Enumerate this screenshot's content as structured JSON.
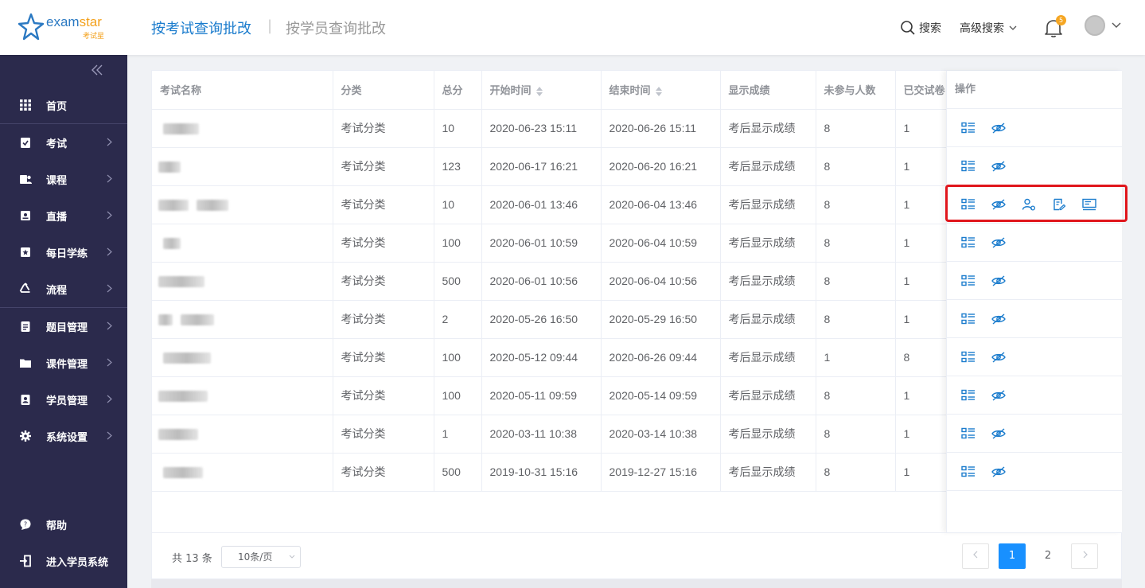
{
  "header": {
    "logo_text": "examstar",
    "logo_cn": "考试星",
    "tab_active": "按考试查询批改",
    "separator": "|",
    "tab_other": "按学员查询批改",
    "search_label": "搜索",
    "advanced_search_label": "高级搜索",
    "notification_count": "5"
  },
  "sidebar": {
    "items": [
      {
        "label": "首页",
        "icon": "grid-icon"
      },
      {
        "label": "考试",
        "icon": "clipboard-check-icon"
      },
      {
        "label": "课程",
        "icon": "course-icon"
      },
      {
        "label": "直播",
        "icon": "live-icon"
      },
      {
        "label": "每日学练",
        "icon": "star-calendar-icon"
      },
      {
        "label": "流程",
        "icon": "recycle-icon"
      },
      {
        "label": "题目管理",
        "icon": "clipboard-list-icon"
      },
      {
        "label": "课件管理",
        "icon": "folder-icon"
      },
      {
        "label": "学员管理",
        "icon": "user-badge-icon"
      },
      {
        "label": "系统设置",
        "icon": "gear-icon"
      },
      {
        "label": "帮助",
        "icon": "help-icon"
      },
      {
        "label": "进入学员系统",
        "icon": "enter-icon"
      }
    ]
  },
  "table": {
    "columns": [
      "考试名称",
      "分类",
      "总分",
      "开始时间",
      "结束时间",
      "显示成绩",
      "未参与人数",
      "已交试卷",
      "操作"
    ],
    "rows": [
      {
        "category": "考试分类",
        "score": "10",
        "start": "2020-06-23 15:11",
        "end": "2020-06-26 15:11",
        "display": "考后显示成绩",
        "absent": "8",
        "submitted": "1"
      },
      {
        "category": "考试分类",
        "score": "123",
        "start": "2020-06-17 16:21",
        "end": "2020-06-20 16:21",
        "display": "考后显示成绩",
        "absent": "8",
        "submitted": "1"
      },
      {
        "category": "考试分类",
        "score": "10",
        "start": "2020-06-01 13:46",
        "end": "2020-06-04 13:46",
        "display": "考后显示成绩",
        "absent": "8",
        "submitted": "1"
      },
      {
        "category": "考试分类",
        "score": "100",
        "start": "2020-06-01 10:59",
        "end": "2020-06-04 10:59",
        "display": "考后显示成绩",
        "absent": "8",
        "submitted": "1"
      },
      {
        "category": "考试分类",
        "score": "500",
        "start": "2020-06-01 10:56",
        "end": "2020-06-04 10:56",
        "display": "考后显示成绩",
        "absent": "8",
        "submitted": "1"
      },
      {
        "category": "考试分类",
        "score": "2",
        "start": "2020-05-26 16:50",
        "end": "2020-05-29 16:50",
        "display": "考后显示成绩",
        "absent": "8",
        "submitted": "1"
      },
      {
        "category": "考试分类",
        "score": "100",
        "start": "2020-05-12 09:44",
        "end": "2020-06-26 09:44",
        "display": "考后显示成绩",
        "absent": "1",
        "submitted": "8"
      },
      {
        "category": "考试分类",
        "score": "100",
        "start": "2020-05-11 09:59",
        "end": "2020-05-14 09:59",
        "display": "考后显示成绩",
        "absent": "8",
        "submitted": "1"
      },
      {
        "category": "考试分类",
        "score": "1",
        "start": "2020-03-11 10:38",
        "end": "2020-03-14 10:38",
        "display": "考后显示成绩",
        "absent": "8",
        "submitted": "1"
      },
      {
        "category": "考试分类",
        "score": "500",
        "start": "2019-10-31 15:16",
        "end": "2019-12-27 15:16",
        "display": "考后显示成绩",
        "absent": "8",
        "submitted": "1"
      }
    ],
    "row_actions_basic": [
      "list-detail-icon",
      "eye-off-icon"
    ],
    "row_actions_expanded": [
      "list-detail-icon",
      "eye-off-icon",
      "user-settings-icon",
      "review-paper-icon",
      "report-icon"
    ],
    "expanded_row": 2
  },
  "pagination": {
    "total_text": "共 13 条",
    "page_size": "10条/页",
    "pages": [
      "1",
      "2"
    ],
    "current_page": "1"
  },
  "colors": {
    "accent": "#1b7ccd",
    "sidebar_bg": "#2b2a4c",
    "highlight": "#e0161c",
    "badge": "#f5a623"
  }
}
